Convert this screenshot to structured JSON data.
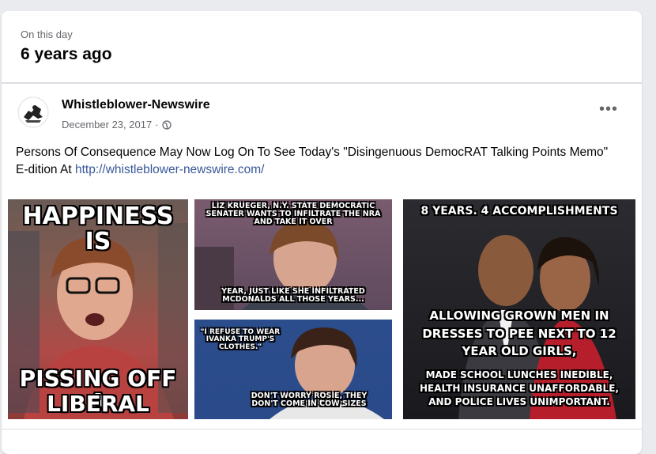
{
  "memory": {
    "label": "On this day",
    "title": "6 years ago"
  },
  "post": {
    "author": "Whistleblower-Newswire",
    "date": "December 23, 2017",
    "privacy_icon": "globe-icon",
    "more_icon": "more-options-icon",
    "text": "Persons Of Consequence May Now Log On To See Today's \"Disingenuous DemocRAT Talking Points Memo\"  E-dition At ",
    "link": "http://whistleblower-newswire.com/"
  },
  "photos": {
    "p1": {
      "top": "HAPPINESS IS",
      "bottom_1": "PISSING OFF A",
      "bottom_2": "LIBERAL"
    },
    "p2": {
      "top": "LIZ KRUEGER, N.Y. STATE DEMOCRATIC SENATER WANTS TO INFILTRATE THE NRA AND TAKE IT OVER",
      "bottom": "YEAR, JUST LIKE SHE INFILTRATED MCDONALDS ALL THOSE YEARS..."
    },
    "p3": {
      "top": "\"I REFUSE TO WEAR IVANKA TRUMP'S CLOTHES.\"",
      "bottom": "DON'T WORRY ROSIE, THEY DON'T COME IN COW SIZES"
    },
    "p4": {
      "top": "8 YEARS. 4 ACCOMPLISHMENTS",
      "mid": "ALLOWING GROWN MEN IN DRESSES TO PEE NEXT TO 12 YEAR OLD GIRLS,",
      "bottom": "MADE SCHOOL LUNCHES INEDIBLE, HEALTH INSURANCE UNAFFORDABLE, AND POLICE LIVES UNIMPORTANT."
    }
  }
}
